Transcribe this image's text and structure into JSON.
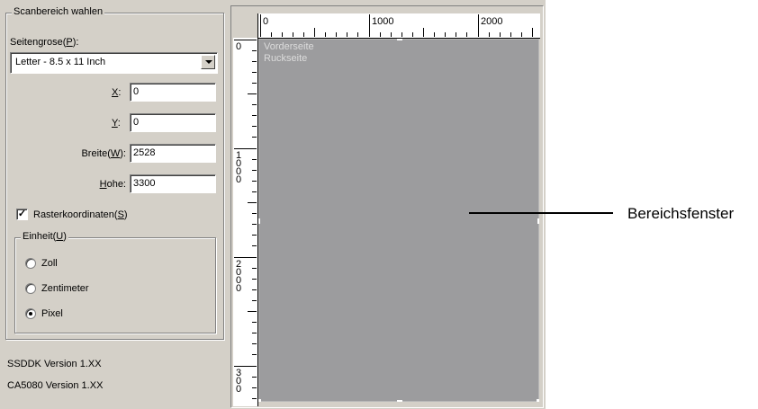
{
  "scan_area_group": {
    "title": "Scanbereich wahlen",
    "page_size_label_pre": "Seitengrose(",
    "page_size_label_key": "P",
    "page_size_label_post": "):",
    "page_size_value": "Letter - 8.5 x 11 Inch",
    "x_label_key": "X",
    "x_label_post": ":",
    "x_value": "0",
    "y_label_key": "Y",
    "y_label_post": ":",
    "y_value": "0",
    "width_label_pre": "Breite(",
    "width_label_key": "W",
    "width_label_post": "):",
    "width_value": "2528",
    "height_label_key": "H",
    "height_label_post": "ohe:",
    "height_value": "3300",
    "grid_coords_label_pre": "Rasterkoordinaten(",
    "grid_coords_label_key": "S",
    "grid_coords_label_post": ")",
    "grid_coords_checked": true,
    "grid_coords_mark": "✓"
  },
  "unit_group": {
    "title_pre": "Einheit(",
    "title_key": "U",
    "title_post": ")",
    "options": [
      {
        "label": "Zoll",
        "selected": false
      },
      {
        "label": "Zentimeter",
        "selected": false
      },
      {
        "label": "Pixel",
        "selected": true
      }
    ]
  },
  "versions": {
    "ssddk": "SSDDK Version 1.XX",
    "ca5080": "CA5080 Version 1.XX"
  },
  "preview": {
    "ruler_h_labels": [
      "0",
      "1000",
      "2000"
    ],
    "ruler_v_labels": [
      "0",
      "1\n0\n0\n0",
      "2\n0\n0\n0",
      "3\n0\n0"
    ],
    "front_label": "Vorderseite",
    "back_label": "Ruckseite",
    "scan_area_color": "#9c9c9e"
  },
  "callout": {
    "label": "Bereichsfenster"
  }
}
